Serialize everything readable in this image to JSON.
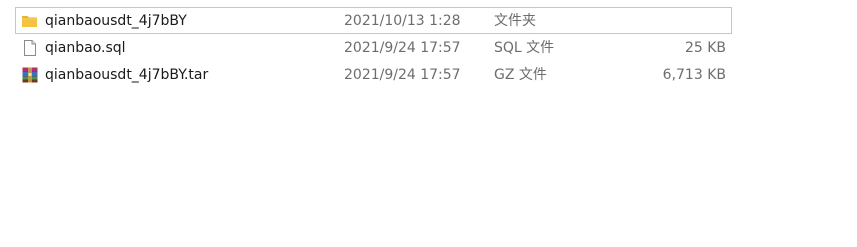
{
  "files": [
    {
      "name": "qianbaousdt_4j7bBY",
      "date": "2021/10/13 1:28",
      "type": "文件夹",
      "size": "",
      "icon": "folder-icon",
      "selected": true
    },
    {
      "name": "qianbao.sql",
      "date": "2021/9/24 17:57",
      "type": "SQL 文件",
      "size": "25 KB",
      "icon": "document-icon",
      "selected": false
    },
    {
      "name": "qianbaousdt_4j7bBY.tar",
      "date": "2021/9/24 17:57",
      "type": "GZ 文件",
      "size": "6,713 KB",
      "icon": "archive-icon",
      "selected": false
    }
  ],
  "colors": {
    "selection_border": "#99d1ff",
    "folder": "#f5c342",
    "secondary_text": "#6d6d6d"
  }
}
